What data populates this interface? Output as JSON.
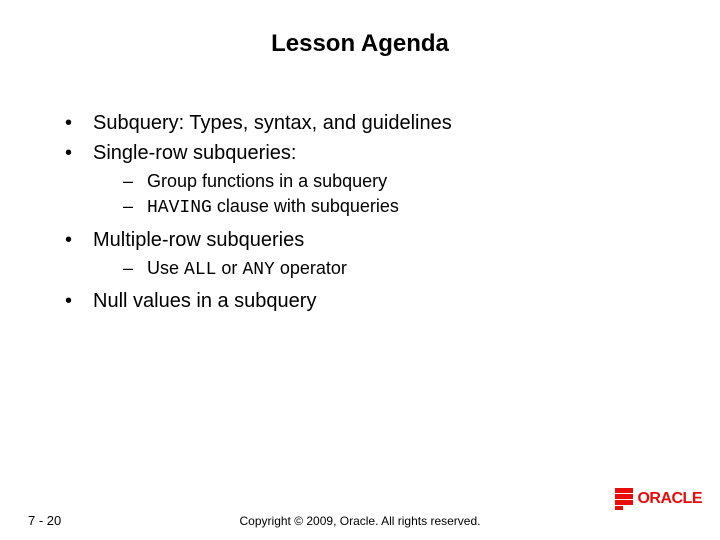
{
  "title": "Lesson Agenda",
  "bullets": {
    "b0": "Subquery: Types, syntax, and guidelines",
    "b1": "Single-row subqueries:",
    "b1_sub0": "Group functions in a subquery",
    "b1_sub1_prefix": "",
    "b1_sub1_code": "HAVING",
    "b1_sub1_suffix": " clause with subqueries",
    "b2": "Multiple-row subqueries",
    "b2_sub0_prefix": "Use ",
    "b2_sub0_code1": "ALL",
    "b2_sub0_mid": " or ",
    "b2_sub0_code2": "ANY",
    "b2_sub0_suffix": " operator",
    "b3": "Null values in a subquery"
  },
  "footer": {
    "page": "7 - 20",
    "copyright": "Copyright © 2009, Oracle. All rights reserved.",
    "logo_text": "ORACLE"
  }
}
